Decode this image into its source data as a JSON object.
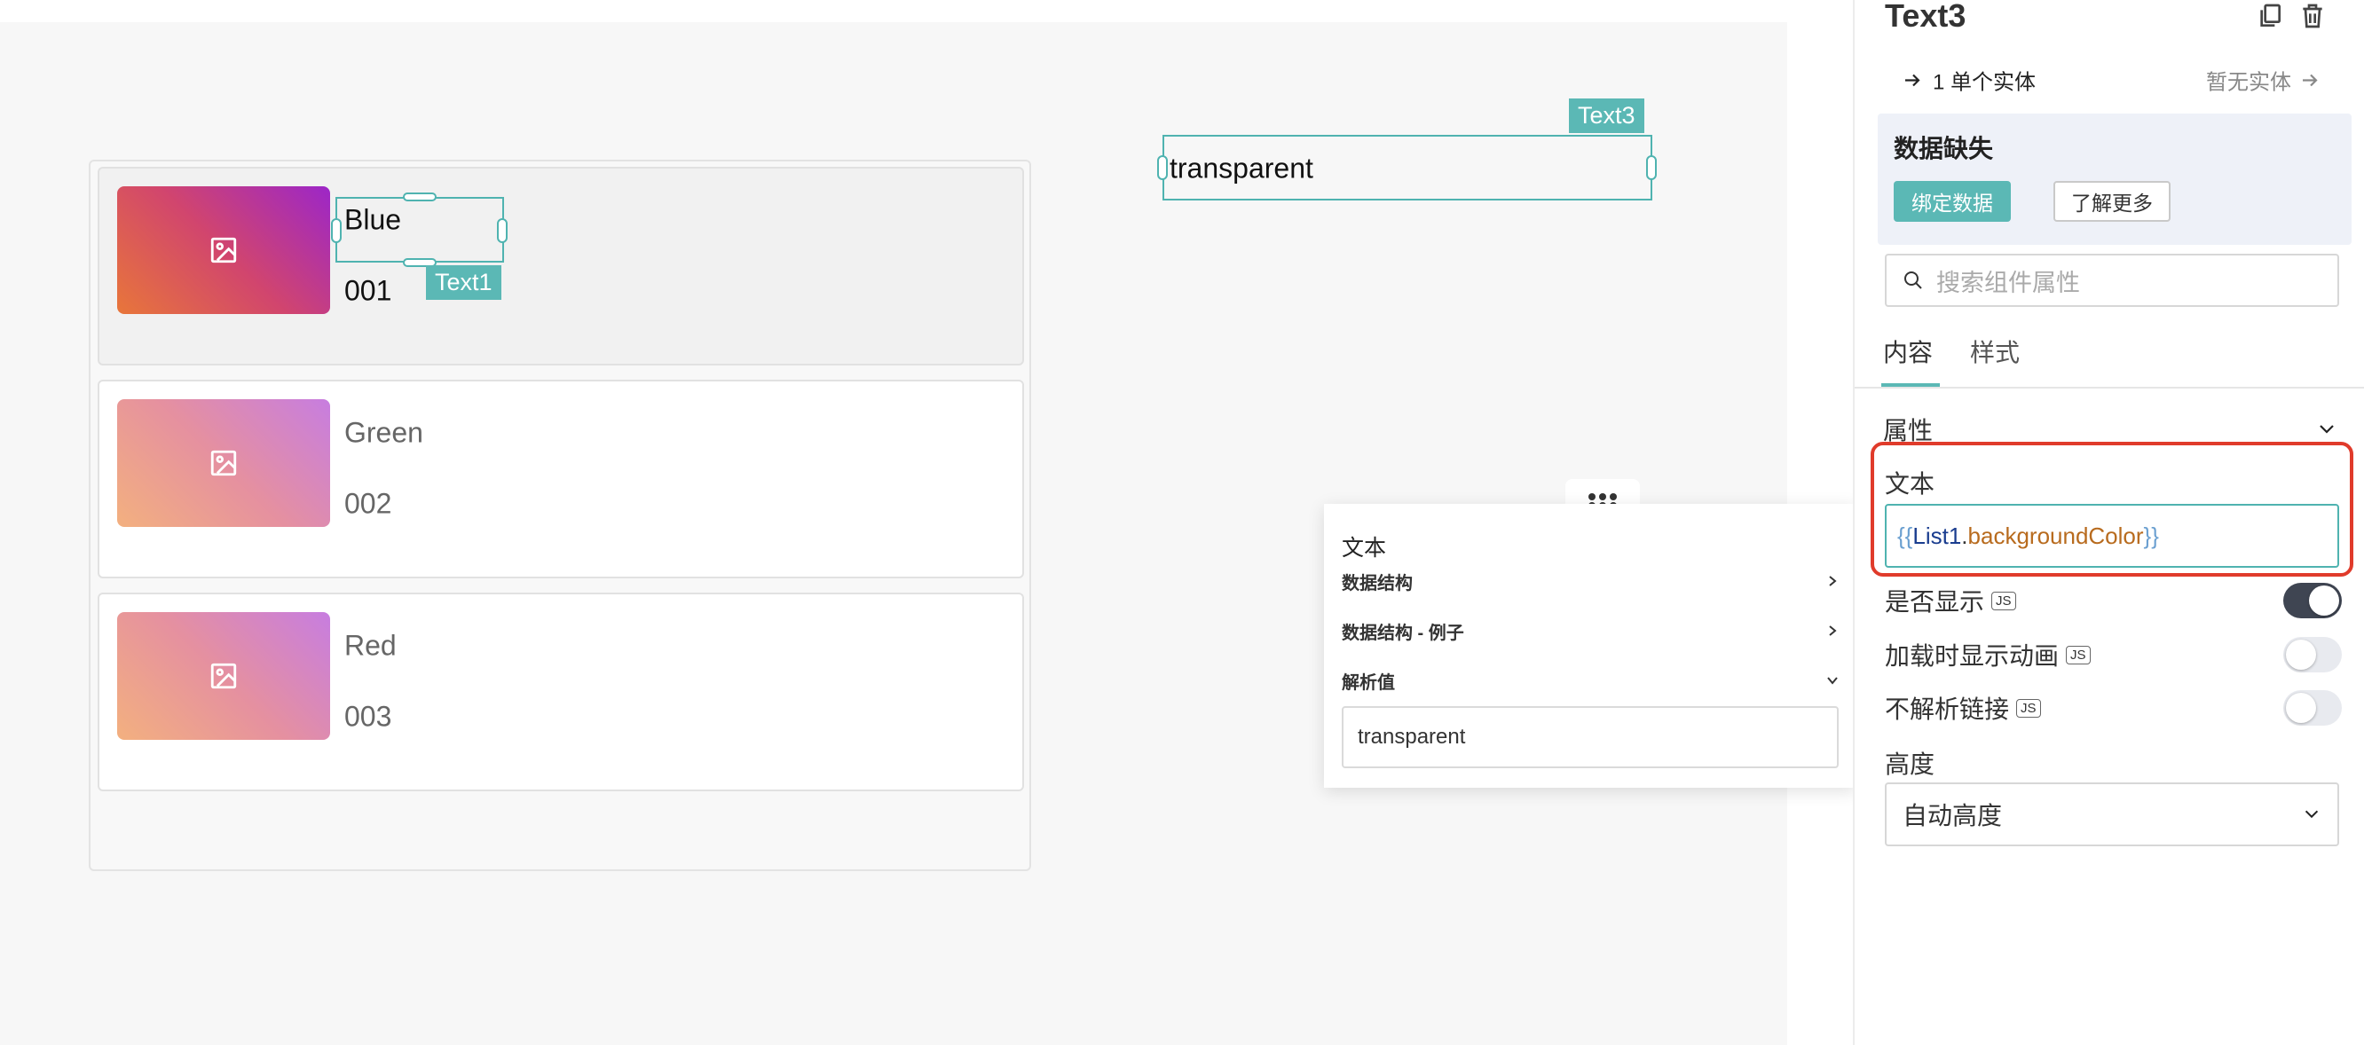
{
  "list": {
    "items": [
      {
        "title": "Blue",
        "code": "001",
        "selected": true
      },
      {
        "title": "Green",
        "code": "002",
        "selected": false
      },
      {
        "title": "Red",
        "code": "003",
        "selected": false
      }
    ],
    "selection_tag": "Text1"
  },
  "text3_widget": {
    "tag": "Text3",
    "value": "transparent"
  },
  "popover": {
    "title": "文本",
    "rows": [
      "数据结构",
      "数据结构 - 例子",
      "解析值"
    ],
    "value": "transparent"
  },
  "panel": {
    "title": "Text3",
    "entity_link": "1 单个实体",
    "entity_right": "暂无实体",
    "missing_title": "数据缺失",
    "bind_button": "绑定数据",
    "learn_more_button": "了解更多",
    "search_placeholder": "搜索组件属性",
    "tabs": [
      "内容",
      "样式"
    ],
    "section": "属性",
    "text_label": "文本",
    "code": {
      "open": "{{",
      "ident": "List1",
      "dot": ".",
      "prop": "backgroundColor",
      "close": "}}"
    },
    "visible_label": "是否显示",
    "animate_label": "加载时显示动画",
    "nolink_label": "不解析链接",
    "js_badge": "JS",
    "height_label": "高度",
    "height_value": "自动高度",
    "toggles": {
      "visible": true,
      "animate": false,
      "nolink": false
    }
  },
  "colors": {
    "accent": "#5bb8b5",
    "highlight": "#e03b2b",
    "toggle_on": "#3f4552"
  }
}
